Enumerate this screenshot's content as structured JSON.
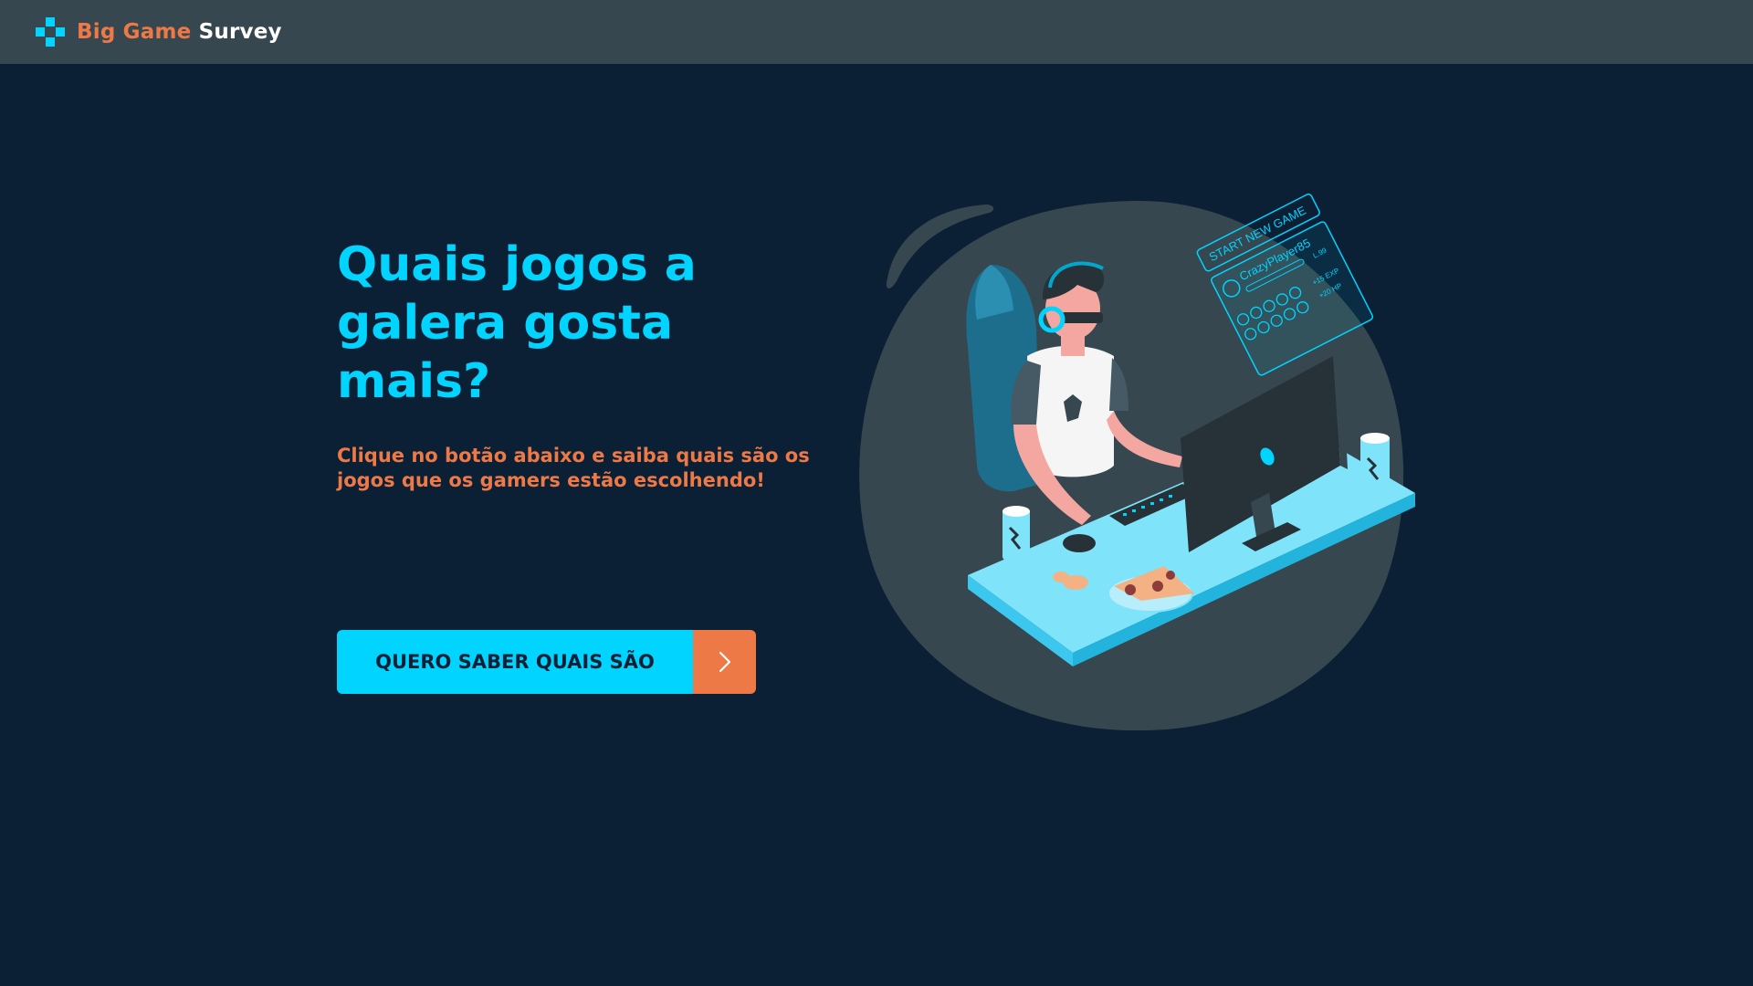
{
  "navbar": {
    "logo_icon": "gamepad-icon",
    "brand_first": "Big Game",
    "brand_second": "Survey"
  },
  "hero": {
    "title": "Quais jogos a galera gosta mais?",
    "subtitle": "Clique no botão abaixo e saiba quais são os jogos que os gamers estão escolhendo!",
    "cta_label": "QUERO SABER QUAIS SÃO",
    "cta_icon": "chevron-right-icon"
  },
  "illustration": {
    "hud_title": "START NEW GAME",
    "hud_player": "CrazyPlayer85",
    "hud_level": "L.99",
    "hud_exp": "+15 EXP",
    "hud_hp": "+20 HP"
  },
  "colors": {
    "background": "#0B1F35",
    "navbar": "#37474F",
    "accent_cyan": "#00D4FF",
    "accent_orange": "#ED7947"
  }
}
